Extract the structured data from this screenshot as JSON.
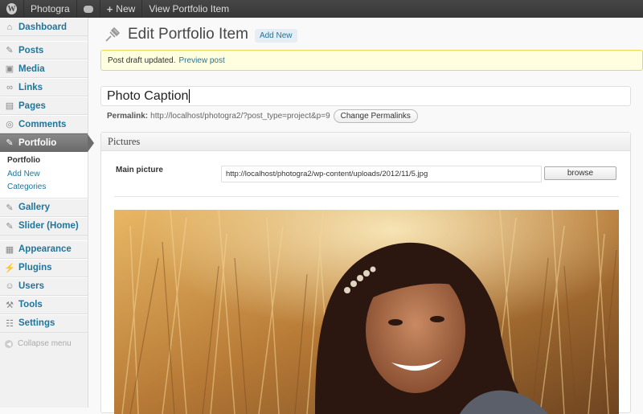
{
  "adminbar": {
    "site_name": "Photogra",
    "new_label": "New",
    "view_label": "View Portfolio Item"
  },
  "sidebar": {
    "items": [
      {
        "label": "Dashboard",
        "icon": "dashboard-icon"
      },
      {
        "label": "Posts",
        "icon": "pushpin-icon"
      },
      {
        "label": "Media",
        "icon": "media-icon"
      },
      {
        "label": "Links",
        "icon": "link-icon"
      },
      {
        "label": "Pages",
        "icon": "pages-icon"
      },
      {
        "label": "Comments",
        "icon": "comments-icon"
      },
      {
        "label": "Portfolio",
        "icon": "pushpin-icon"
      },
      {
        "label": "Gallery",
        "icon": "pushpin-icon"
      },
      {
        "label": "Slider (Home)",
        "icon": "pushpin-icon"
      },
      {
        "label": "Appearance",
        "icon": "appearance-icon"
      },
      {
        "label": "Plugins",
        "icon": "plugins-icon"
      },
      {
        "label": "Users",
        "icon": "users-icon"
      },
      {
        "label": "Tools",
        "icon": "tools-icon"
      },
      {
        "label": "Settings",
        "icon": "settings-icon"
      }
    ],
    "submenu": [
      "Portfolio",
      "Add New",
      "Categories"
    ],
    "collapse_label": "Collapse menu"
  },
  "page": {
    "title": "Edit Portfolio Item",
    "add_new": "Add New",
    "notice_text": "Post draft updated.",
    "notice_link": "Preview post",
    "post_title": "Photo Caption",
    "permalink_label": "Permalink:",
    "permalink_url": "http://localhost/photogra2/?post_type=project&p=9",
    "change_permalinks": "Change Permalinks"
  },
  "pictures_box": {
    "heading": "Pictures",
    "main_picture_label": "Main picture",
    "main_picture_value": "http://localhost/photogra2/wp-content/uploads/2012/11/5.jpg",
    "browse_label": "browse"
  },
  "colors": {
    "link": "#21759b",
    "adminbar": "#464646",
    "current_menu": "#6d6d6d",
    "notice_bg": "#ffffe0"
  }
}
